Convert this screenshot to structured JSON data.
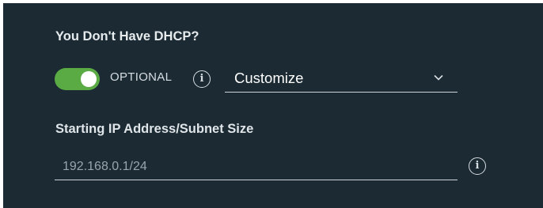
{
  "dhcp": {
    "title": "You Don't Have DHCP?",
    "toggle_on": true,
    "optional_label": "OPTIONAL",
    "info_glyph": "i",
    "mode_value": "Customize"
  },
  "ip_field": {
    "label": "Starting IP Address/Subnet Size",
    "placeholder": "192.168.0.1/24"
  },
  "icons": {
    "toggle": "toggle-switch",
    "info": "info-icon",
    "dropdown": "chevron-down-icon"
  },
  "colors": {
    "background": "#1b2a33",
    "toggle_on": "#5bab45",
    "text": "#e6ebee"
  }
}
